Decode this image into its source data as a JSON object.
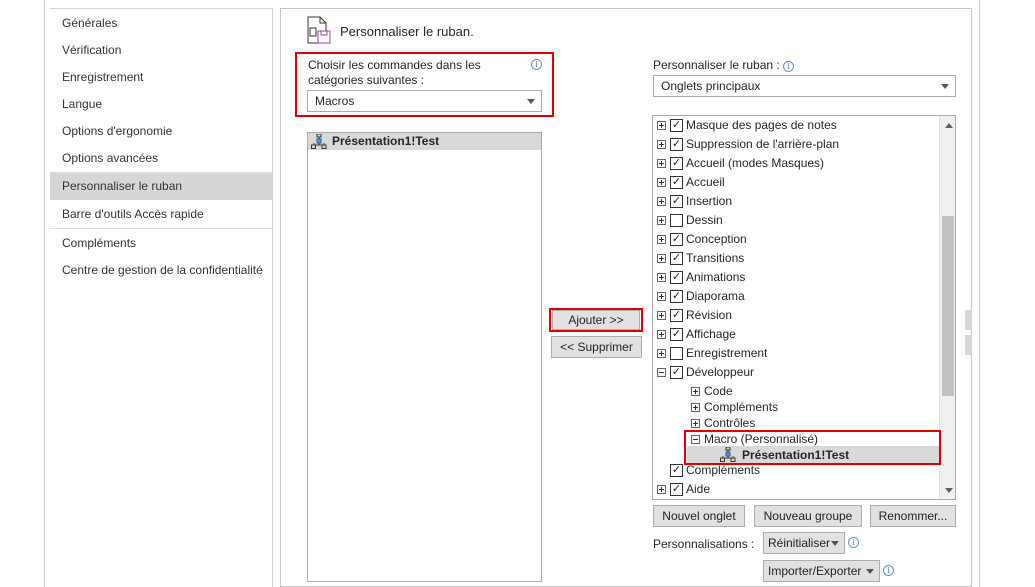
{
  "sidebar": {
    "items": [
      {
        "label": "Générales"
      },
      {
        "label": "Vérification"
      },
      {
        "label": "Enregistrement"
      },
      {
        "label": "Langue"
      },
      {
        "label": "Options d'ergonomie"
      },
      {
        "label": "Options avancées"
      },
      {
        "label": "Personnaliser le ruban",
        "selected": true
      },
      {
        "label": "Barre d'outils Accès rapide"
      },
      {
        "label": "Compléments"
      },
      {
        "label": "Centre de gestion de la confidentialité"
      }
    ]
  },
  "header": {
    "title": "Personnaliser le ruban."
  },
  "left": {
    "choose_label_1": "Choisir les commandes dans les",
    "choose_label_2": "catégories suivantes :",
    "category_value": "Macros",
    "commands": [
      {
        "label": "Présentation1!Test",
        "icon": "macro-icon"
      }
    ]
  },
  "middle": {
    "add_label": "Ajouter >>",
    "remove_label": "<< Supprimer"
  },
  "right": {
    "customize_label": "Personnaliser le ruban :",
    "tabs_value": "Onglets principaux",
    "tree": [
      {
        "label": "Masque des pages de notes",
        "checked": true,
        "expander": "plus"
      },
      {
        "label": "Suppression de l'arrière-plan",
        "checked": true,
        "expander": "plus"
      },
      {
        "label": "Accueil (modes Masques)",
        "checked": true,
        "expander": "plus"
      },
      {
        "label": "Accueil",
        "checked": true,
        "expander": "plus"
      },
      {
        "label": "Insertion",
        "checked": true,
        "expander": "plus"
      },
      {
        "label": "Dessin",
        "checked": false,
        "expander": "plus"
      },
      {
        "label": "Conception",
        "checked": true,
        "expander": "plus"
      },
      {
        "label": "Transitions",
        "checked": true,
        "expander": "plus"
      },
      {
        "label": "Animations",
        "checked": true,
        "expander": "plus"
      },
      {
        "label": "Diaporama",
        "checked": true,
        "expander": "plus"
      },
      {
        "label": "Révision",
        "checked": true,
        "expander": "plus"
      },
      {
        "label": "Affichage",
        "checked": true,
        "expander": "plus"
      },
      {
        "label": "Enregistrement",
        "checked": false,
        "expander": "plus"
      },
      {
        "label": "Développeur",
        "checked": true,
        "expander": "minus"
      }
    ],
    "dev_groups": [
      {
        "label": "Code"
      },
      {
        "label": "Compléments"
      },
      {
        "label": "Contrôles"
      }
    ],
    "custom_group": {
      "label": "Macro (Personnalisé)",
      "child": "Présentation1!Test"
    },
    "tail": [
      {
        "label": "Compléments",
        "checked": true
      },
      {
        "label": "Aide",
        "checked": true
      }
    ],
    "new_tab": "Nouvel onglet",
    "new_group": "Nouveau groupe",
    "rename": "Renommer...",
    "customizations_label": "Personnalisations :",
    "reset": "Réinitialiser",
    "import_export": "Importer/Exporter"
  },
  "colors": {
    "highlight": "#e00000",
    "selection": "#d6d6d6"
  }
}
